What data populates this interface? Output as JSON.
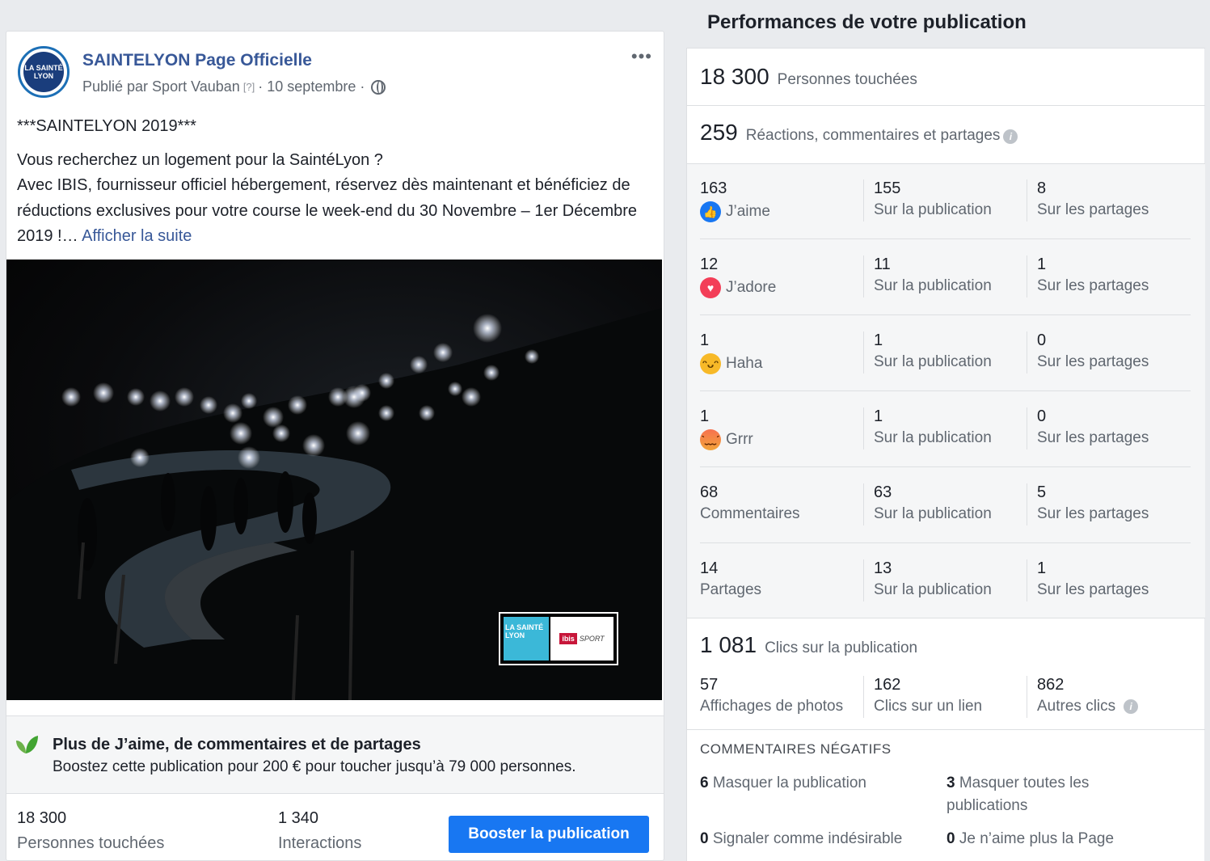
{
  "post": {
    "page_name": "SAINTELYON Page Officielle",
    "avatar_text": "LA SAINTÉ LYON",
    "published_by": "Publié par Sport Vauban",
    "help_marker": "[?]",
    "date": "· 10 septembre ·",
    "more_menu": "•••",
    "title_line": "***SAINTELYON 2019***",
    "body_lines": [
      "Vous recherchez un logement pour la SaintéLyon ?",
      "Avec IBIS, fournisseur officiel hébergement, réservez dès maintenant et bénéficiez de réductions exclusives pour votre course le week-end du 30 Novembre – 1er Décembre 2019 !…"
    ],
    "see_more": "Afficher la suite",
    "sponsor": {
      "left": "LA SAINTÉ LYON",
      "brand": "ibis",
      "right": "SPORT"
    }
  },
  "promo": {
    "title": "Plus de J’aime, de commentaires et de partages",
    "subtitle": "Boostez cette publication pour 200 € pour toucher jusqu’à 79 000 personnes."
  },
  "post_stats": {
    "reach_value": "18 300",
    "reach_label": "Personnes touchées",
    "interactions_value": "1 340",
    "interactions_label": "Interactions",
    "boost_button": "Booster la publication"
  },
  "panel": {
    "title": "Performances de votre publication",
    "reach": {
      "value": "18 300",
      "label": "Personnes touchées"
    },
    "engagement": {
      "value": "259",
      "label": "Réactions, commentaires et partages"
    },
    "rows": [
      {
        "total": "163",
        "label": "J’aime",
        "icon": "like-icon",
        "on_post": "155",
        "on_shares": "8"
      },
      {
        "total": "12",
        "label": "J’adore",
        "icon": "love-icon",
        "on_post": "11",
        "on_shares": "1"
      },
      {
        "total": "1",
        "label": "Haha",
        "icon": "haha-icon",
        "on_post": "1",
        "on_shares": "0"
      },
      {
        "total": "1",
        "label": "Grrr",
        "icon": "angry-icon",
        "on_post": "1",
        "on_shares": "0"
      },
      {
        "total": "68",
        "label": "Commentaires",
        "icon": "",
        "on_post": "63",
        "on_shares": "5"
      },
      {
        "total": "14",
        "label": "Partages",
        "icon": "",
        "on_post": "13",
        "on_shares": "1"
      }
    ],
    "on_post_label": "Sur la publication",
    "on_shares_label": "Sur les partages",
    "clicks": {
      "value": "1 081",
      "label": "Clics sur la publication"
    },
    "click_breakdown": [
      {
        "value": "57",
        "label": "Affichages de photos"
      },
      {
        "value": "162",
        "label": "Clics sur un lien"
      },
      {
        "value": "862",
        "label": "Autres clics"
      }
    ],
    "negative": {
      "title": "COMMENTAIRES NÉGATIFS",
      "items": [
        {
          "value": "6",
          "label": "Masquer la publication"
        },
        {
          "value": "3",
          "label": "Masquer toutes les publications"
        },
        {
          "value": "0",
          "label": "Signaler comme indésirable"
        },
        {
          "value": "0",
          "label": "Je n’aime plus la Page"
        }
      ]
    }
  },
  "colors": {
    "link": "#385898",
    "primary_button": "#1877f2",
    "muted_text": "#606770"
  }
}
